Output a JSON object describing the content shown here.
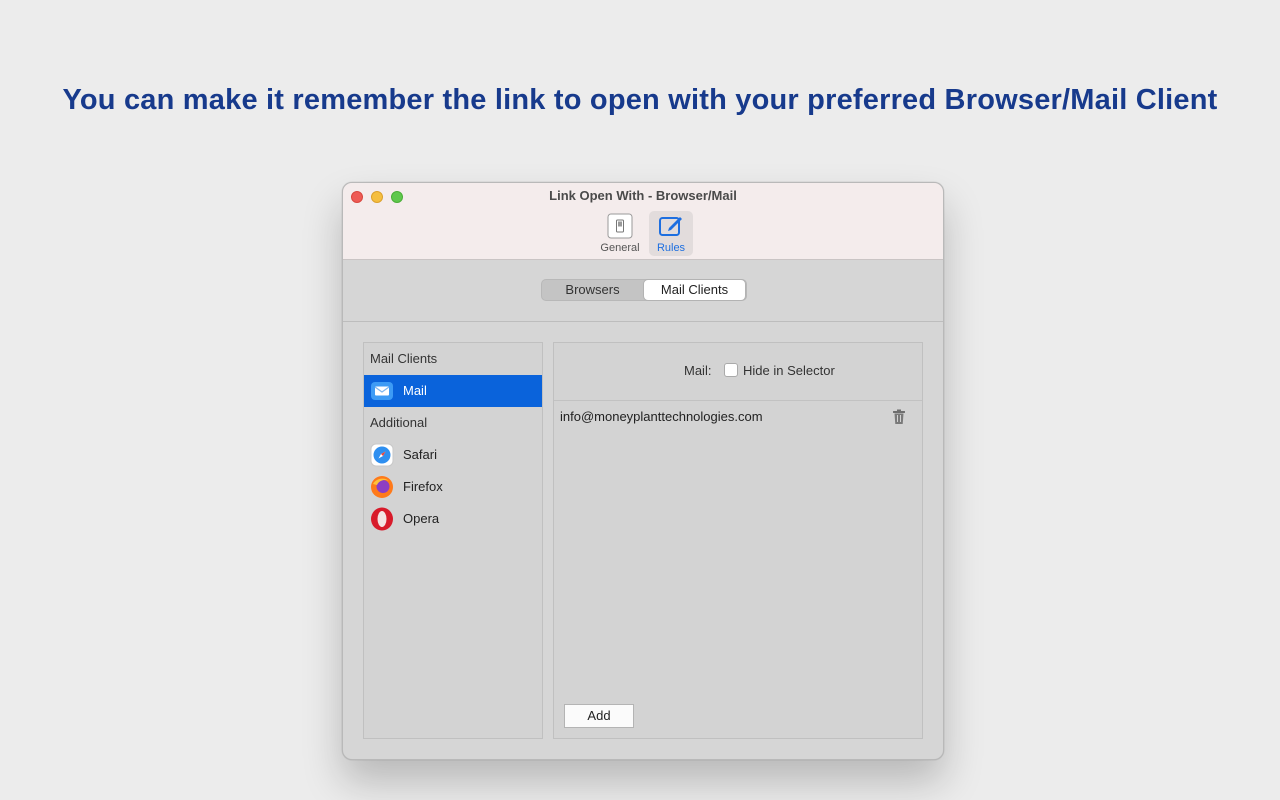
{
  "headline": "You can make it remember the link to open with your preferred Browser/Mail Client",
  "window": {
    "title": "Link Open With - Browser/Mail",
    "toolbar": {
      "general_label": "General",
      "rules_label": "Rules",
      "general_icon": "switch-icon",
      "rules_icon": "edit-icon"
    },
    "segmented": {
      "browsers_label": "Browsers",
      "mail_clients_label": "Mail Clients",
      "selected": "Mail Clients"
    },
    "sidebar": {
      "header_mail_clients": "Mail Clients",
      "header_additional": "Additional",
      "items": [
        {
          "label": "Mail",
          "icon": "mail-icon",
          "selected": true
        },
        {
          "label": "Safari",
          "icon": "safari-icon",
          "selected": false
        },
        {
          "label": "Firefox",
          "icon": "firefox-icon",
          "selected": false
        },
        {
          "label": "Opera",
          "icon": "opera-icon",
          "selected": false
        }
      ]
    },
    "detail": {
      "mail_label": "Mail:",
      "hide_label": "Hide in Selector",
      "hide_checked": false,
      "rules": [
        "info@moneyplanttechnologies.com"
      ],
      "add_label": "Add"
    }
  },
  "colors": {
    "headline": "#173a8c",
    "selection": "#0a63db",
    "accent": "#1e6fe0"
  }
}
